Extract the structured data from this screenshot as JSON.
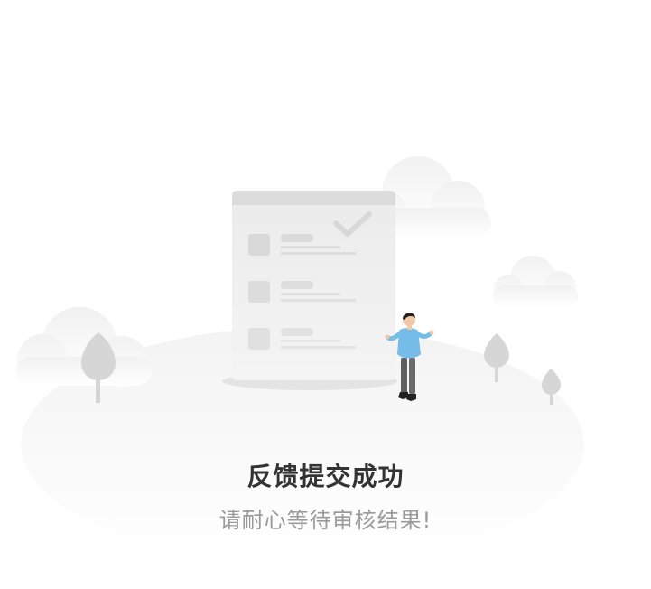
{
  "result": {
    "title": "反馈提交成功",
    "subtitle": "请耐心等待审核结果!"
  },
  "illustration": {
    "icon": "feedback-success-illustration",
    "colors": {
      "cloud": "#f4f4f4",
      "ground": "#f7f7f7",
      "document": "#e6e6e6",
      "document_line": "#d6d6d6",
      "tree": "#d4d4d4",
      "person_shirt": "#75bde8",
      "person_pants": "#6a6a6a",
      "person_hair": "#222222"
    }
  }
}
